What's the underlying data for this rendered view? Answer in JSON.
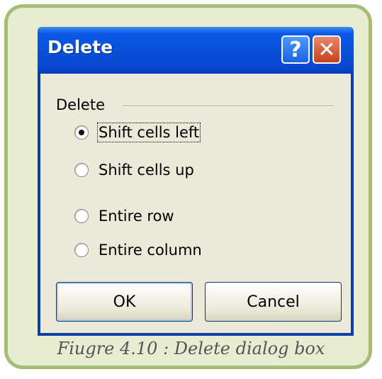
{
  "dialog": {
    "title": "Delete",
    "help_symbol": "?",
    "close_symbol": "✕",
    "group_label": "Delete",
    "options": [
      {
        "label": "Shift cells left",
        "selected": true
      },
      {
        "label": "Shift cells up",
        "selected": false
      },
      {
        "label": "Entire row",
        "selected": false
      },
      {
        "label": "Entire column",
        "selected": false
      }
    ],
    "ok_label": "OK",
    "cancel_label": "Cancel"
  },
  "caption": "Fiugre 4.10 : Delete dialog box",
  "colors": {
    "titlebar": "#0a4fd8",
    "close_button": "#d9552e",
    "panel_background": "#e6edd0",
    "panel_border": "#a6bd78"
  },
  "icons": {
    "help": "question-mark-icon",
    "close": "close-icon"
  }
}
